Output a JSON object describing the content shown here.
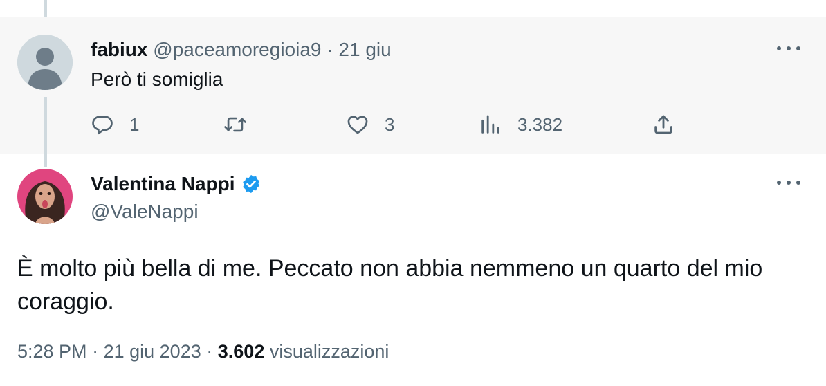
{
  "reply": {
    "author_name": "fabiux",
    "author_handle": "@paceamoregioia9",
    "separator": "·",
    "date": "21 giu",
    "text": "Però ti somiglia",
    "stats": {
      "replies": "1",
      "likes": "3",
      "views": "3.382"
    },
    "icons": {
      "avatar": "default-avatar-icon",
      "reply": "reply-icon",
      "retweet": "retweet-icon",
      "like": "heart-icon",
      "views": "analytics-icon",
      "share": "share-icon",
      "more": "more-icon"
    }
  },
  "tweet": {
    "author_name": "Valentina Nappi",
    "author_handle": "@ValeNappi",
    "text": "È molto più bella di me. Peccato non abbia nemmeno un quarto del mio coraggio.",
    "time": "5:28 PM",
    "separator": "·",
    "date": "21 giu 2023",
    "views_count": "3.602",
    "views_label": "visualizzazioni",
    "icons": {
      "verified": "verified-badge-icon",
      "more": "more-icon"
    }
  },
  "colors": {
    "text_primary": "#0f1419",
    "text_secondary": "#536471",
    "reply_background": "#f7f7f7",
    "thread_line": "#cfd9de",
    "verified_blue": "#1d9bf0",
    "avatar_background": "#e0457f"
  }
}
